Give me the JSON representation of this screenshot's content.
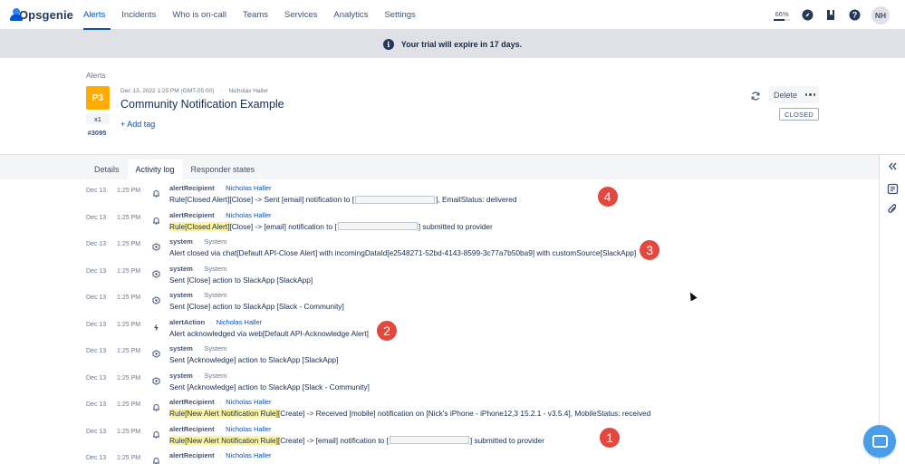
{
  "nav": {
    "brand": "Opsgenie",
    "items": [
      {
        "label": "Alerts",
        "active": true
      },
      {
        "label": "Incidents",
        "active": false
      },
      {
        "label": "Who is on-call",
        "active": false
      },
      {
        "label": "Teams",
        "active": false
      },
      {
        "label": "Services",
        "active": false
      },
      {
        "label": "Analytics",
        "active": false
      },
      {
        "label": "Settings",
        "active": false
      }
    ],
    "progress_label": "66%",
    "progress_value": 0.66,
    "avatar_initials": "NH"
  },
  "banner": {
    "icon_text": "i",
    "text": "Your trial will expire in 17 days."
  },
  "alert": {
    "breadcrumb": "Alerts",
    "priority": "P3",
    "count": "x1",
    "number": "#3095",
    "created": "Dec 13, 2022 1:25 PM (GMT-05:00)",
    "owner": "Nicholas Haller",
    "title": "Community Notification Example",
    "add_tag": "+ Add tag",
    "delete_label": "Delete",
    "status": "CLOSED"
  },
  "tabs": [
    {
      "label": "Details",
      "active": false
    },
    {
      "label": "Activity log",
      "active": true
    },
    {
      "label": "Responder states",
      "active": false
    }
  ],
  "log": [
    {
      "date": "Dec 13",
      "time": "1:25 PM",
      "icon": "bell-icon",
      "actor": "alertRecipient",
      "who": "Nicholas Haller",
      "parts": [
        {
          "t": "Rule[Closed Alert][Close] -> Sent [email] notification to [",
          "hl": false
        },
        {
          "redact": 88
        },
        {
          "t": "], EmailStatus: delivered",
          "hl": false
        }
      ]
    },
    {
      "date": "Dec 13",
      "time": "1:25 PM",
      "icon": "bell-icon",
      "actor": "alertRecipient",
      "who": "Nicholas Haller",
      "parts": [
        {
          "t": "Rule[Closed Alert][",
          "hl": true
        },
        {
          "t": "Close] -> [email] notification to [",
          "hl": false
        },
        {
          "redact": 88
        },
        {
          "t": "] submitted to provider",
          "hl": false
        }
      ]
    },
    {
      "date": "Dec 13",
      "time": "1:25 PM",
      "icon": "system-icon",
      "actor": "system",
      "who": "System",
      "parts": [
        {
          "t": "Alert closed via chat[Default API-Close Alert] with incomingDataId[e2548271-52bd-4143-8599-3c77a7b50ba9] with customSource[SlackApp]",
          "hl": false
        }
      ]
    },
    {
      "date": "Dec 13",
      "time": "1:25 PM",
      "icon": "system-icon",
      "actor": "system",
      "who": "System",
      "parts": [
        {
          "t": "Sent [Close] action to SlackApp [SlackApp]",
          "hl": false
        }
      ]
    },
    {
      "date": "Dec 13",
      "time": "1:25 PM",
      "icon": "system-icon",
      "actor": "system",
      "who": "System",
      "parts": [
        {
          "t": "Sent [Close] action to SlackApp [Slack - Community]",
          "hl": false
        }
      ]
    },
    {
      "date": "Dec 13",
      "time": "1:25 PM",
      "icon": "bolt-icon",
      "actor": "alertAction",
      "who": "Nicholas Haller",
      "parts": [
        {
          "t": "Alert acknowledged via web[Default API-Acknowledge Alert]",
          "hl": false
        }
      ]
    },
    {
      "date": "Dec 13",
      "time": "1:25 PM",
      "icon": "system-icon",
      "actor": "system",
      "who": "System",
      "parts": [
        {
          "t": "Sent [Acknowledge] action to SlackApp [SlackApp]",
          "hl": false
        }
      ]
    },
    {
      "date": "Dec 13",
      "time": "1:25 PM",
      "icon": "system-icon",
      "actor": "system",
      "who": "System",
      "parts": [
        {
          "t": "Sent [Acknowledge] action to SlackApp [Slack - Community]",
          "hl": false
        }
      ]
    },
    {
      "date": "Dec 13",
      "time": "1:25 PM",
      "icon": "bell-icon",
      "actor": "alertRecipient",
      "who": "Nicholas Haller",
      "parts": [
        {
          "t": "Rule[New Alert Notification Rule][",
          "hl": true
        },
        {
          "t": "Create] -> Received [mobile] notification on [Nick's iPhone - iPhone12,3 15.2.1 - v3.5.4], MobileStatus: received",
          "hl": false
        }
      ]
    },
    {
      "date": "Dec 13",
      "time": "1:25 PM",
      "icon": "bell-icon",
      "actor": "alertRecipient",
      "who": "Nicholas Haller",
      "parts": [
        {
          "t": "Rule[New Alert Notification Rule][",
          "hl": true
        },
        {
          "t": "Create] -> [email] notification to [",
          "hl": false
        },
        {
          "redact": 88
        },
        {
          "t": "] submitted to provider",
          "hl": false
        }
      ]
    },
    {
      "date": "Dec 13",
      "time": "1:25 PM",
      "icon": "bell-icon",
      "actor": "alertRecipient",
      "who": "Nicholas Haller",
      "parts": []
    }
  ],
  "markers": [
    {
      "label": "4",
      "row": 0
    },
    {
      "label": "3",
      "row": 2
    },
    {
      "label": "2",
      "row": 5
    },
    {
      "label": "1",
      "row": 9
    }
  ],
  "colors": {
    "accent": "#0052cc",
    "priority": "#ffab00",
    "marker": "#e2483d",
    "highlight": "#fff59d"
  }
}
